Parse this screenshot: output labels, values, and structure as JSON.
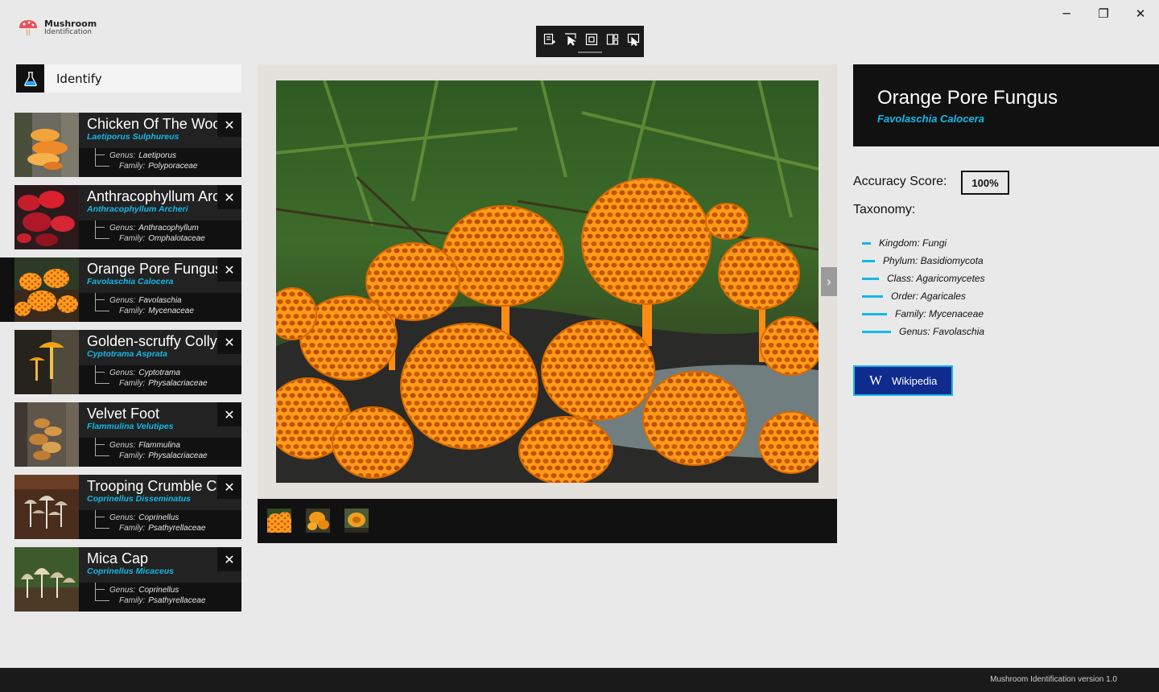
{
  "app": {
    "title": "Mushroom",
    "subtitle": "Identification"
  },
  "window_controls": {
    "minimize": "─",
    "maximize": "❐",
    "close": "✕"
  },
  "dev_toolbar": {
    "tools": [
      "live-visual-tree-icon",
      "select-element-icon",
      "display-layout-adorners-icon",
      "track-focus-icon",
      "toggle-selection-icon"
    ]
  },
  "identify": {
    "label": "Identify",
    "icon": "flask-icon"
  },
  "history": [
    {
      "name": "Chicken Of The Woods",
      "scientific": "Laetiporus Sulphureus",
      "genus": "Laetiporus",
      "family": "Polyporaceae",
      "selected": false
    },
    {
      "name": "Anthracophyllum Archeri",
      "scientific": "Anthracophyllum Archeri",
      "genus": "Anthracophyllum",
      "family": "Omphalotaceae",
      "selected": false
    },
    {
      "name": "Orange Pore Fungus",
      "scientific": "Favolaschia Calocera",
      "genus": "Favolaschia",
      "family": "Mycenaceae",
      "selected": true
    },
    {
      "name": "Golden-scruffy Collybia",
      "scientific": "Cyptotrama Asprata",
      "genus": "Cyptotrama",
      "family": "Physalacriaceae",
      "selected": false
    },
    {
      "name": "Velvet Foot",
      "scientific": "Flammulina Velutipes",
      "genus": "Flammulina",
      "family": "Physalacriaceae",
      "selected": false
    },
    {
      "name": "Trooping Crumble Cap",
      "scientific": "Coprinellus Disseminatus",
      "genus": "Coprinellus",
      "family": "Psathyrellaceae",
      "selected": false
    },
    {
      "name": "Mica Cap",
      "scientific": "Coprinellus Micaceus",
      "genus": "Coprinellus",
      "family": "Psathyrellaceae",
      "selected": false
    }
  ],
  "labels": {
    "genus": "Genus:",
    "family": "Family:",
    "close": "✕",
    "next": "›"
  },
  "details": {
    "name": "Orange Pore Fungus",
    "scientific": "Favolaschia Calocera",
    "accuracy_label": "Accuracy Score:",
    "accuracy_value": "100%",
    "taxonomy_label": "Taxonomy:",
    "taxonomy": [
      "Kingdom: Fungi",
      "Phylum: Basidiomycota",
      "Class: Agaricomycetes",
      "Order: Agaricales",
      "Family: Mycenaceae",
      "Genus: Favolaschia"
    ],
    "wiki_label": "Wikipedia"
  },
  "status": {
    "version": "Mushroom Identification version 1.0"
  },
  "colors": {
    "accent": "#14b8e8",
    "dark": "#111111",
    "wiki_bg": "#0f2b8e",
    "background": "#e9e9e9"
  }
}
